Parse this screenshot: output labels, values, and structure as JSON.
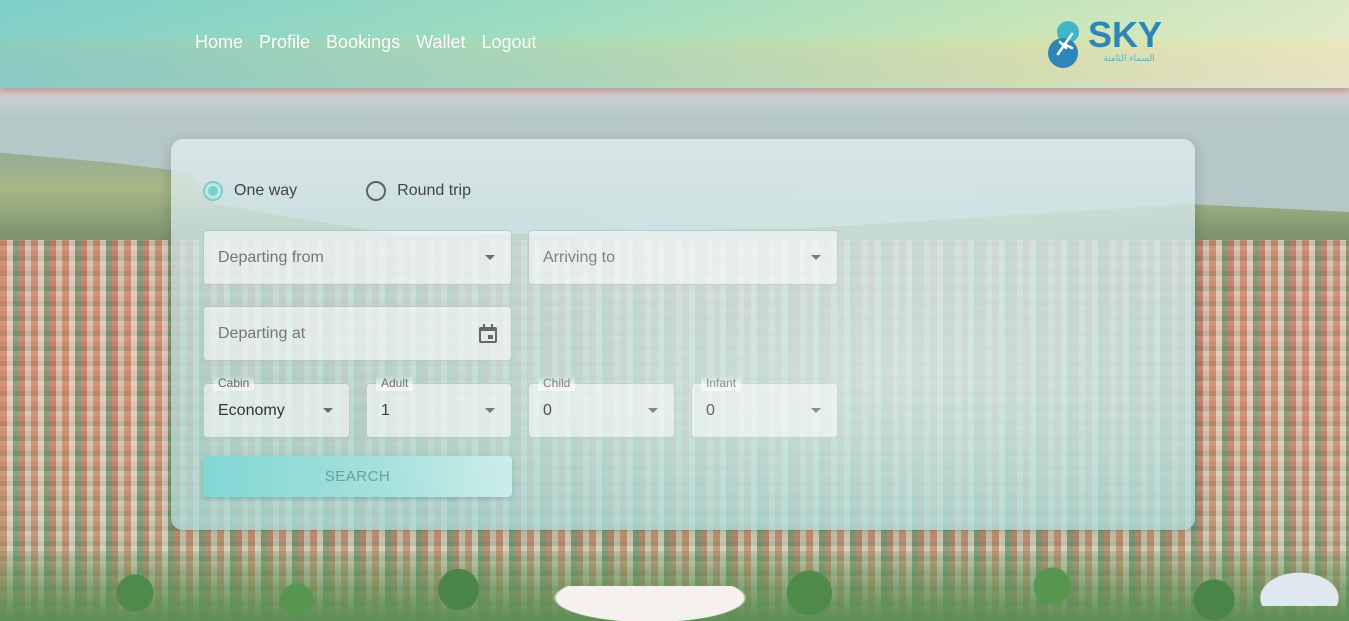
{
  "nav": {
    "items": [
      "Home",
      "Profile",
      "Bookings",
      "Wallet",
      "Logout"
    ]
  },
  "logo": {
    "text": "SKY",
    "subtitle": "السماء الثامنة"
  },
  "trip_type": {
    "one_way": "One way",
    "round_trip": "Round trip",
    "selected": "One way"
  },
  "fields": {
    "departing_from": {
      "placeholder": "Departing from"
    },
    "arriving_to": {
      "placeholder": "Arriving to"
    },
    "departing_at": {
      "placeholder": "Departing at"
    },
    "cabin": {
      "label": "Cabin",
      "value": "Economy"
    },
    "adult": {
      "label": "Adult",
      "value": "1"
    },
    "child": {
      "label": "Child",
      "value": "0"
    },
    "infant": {
      "label": "Infant",
      "value": "0"
    }
  },
  "search_button": "SEARCH",
  "colors": {
    "accent": "#6fd3d0",
    "logo_blue": "#2e86b8",
    "button": "#82d7d3"
  }
}
